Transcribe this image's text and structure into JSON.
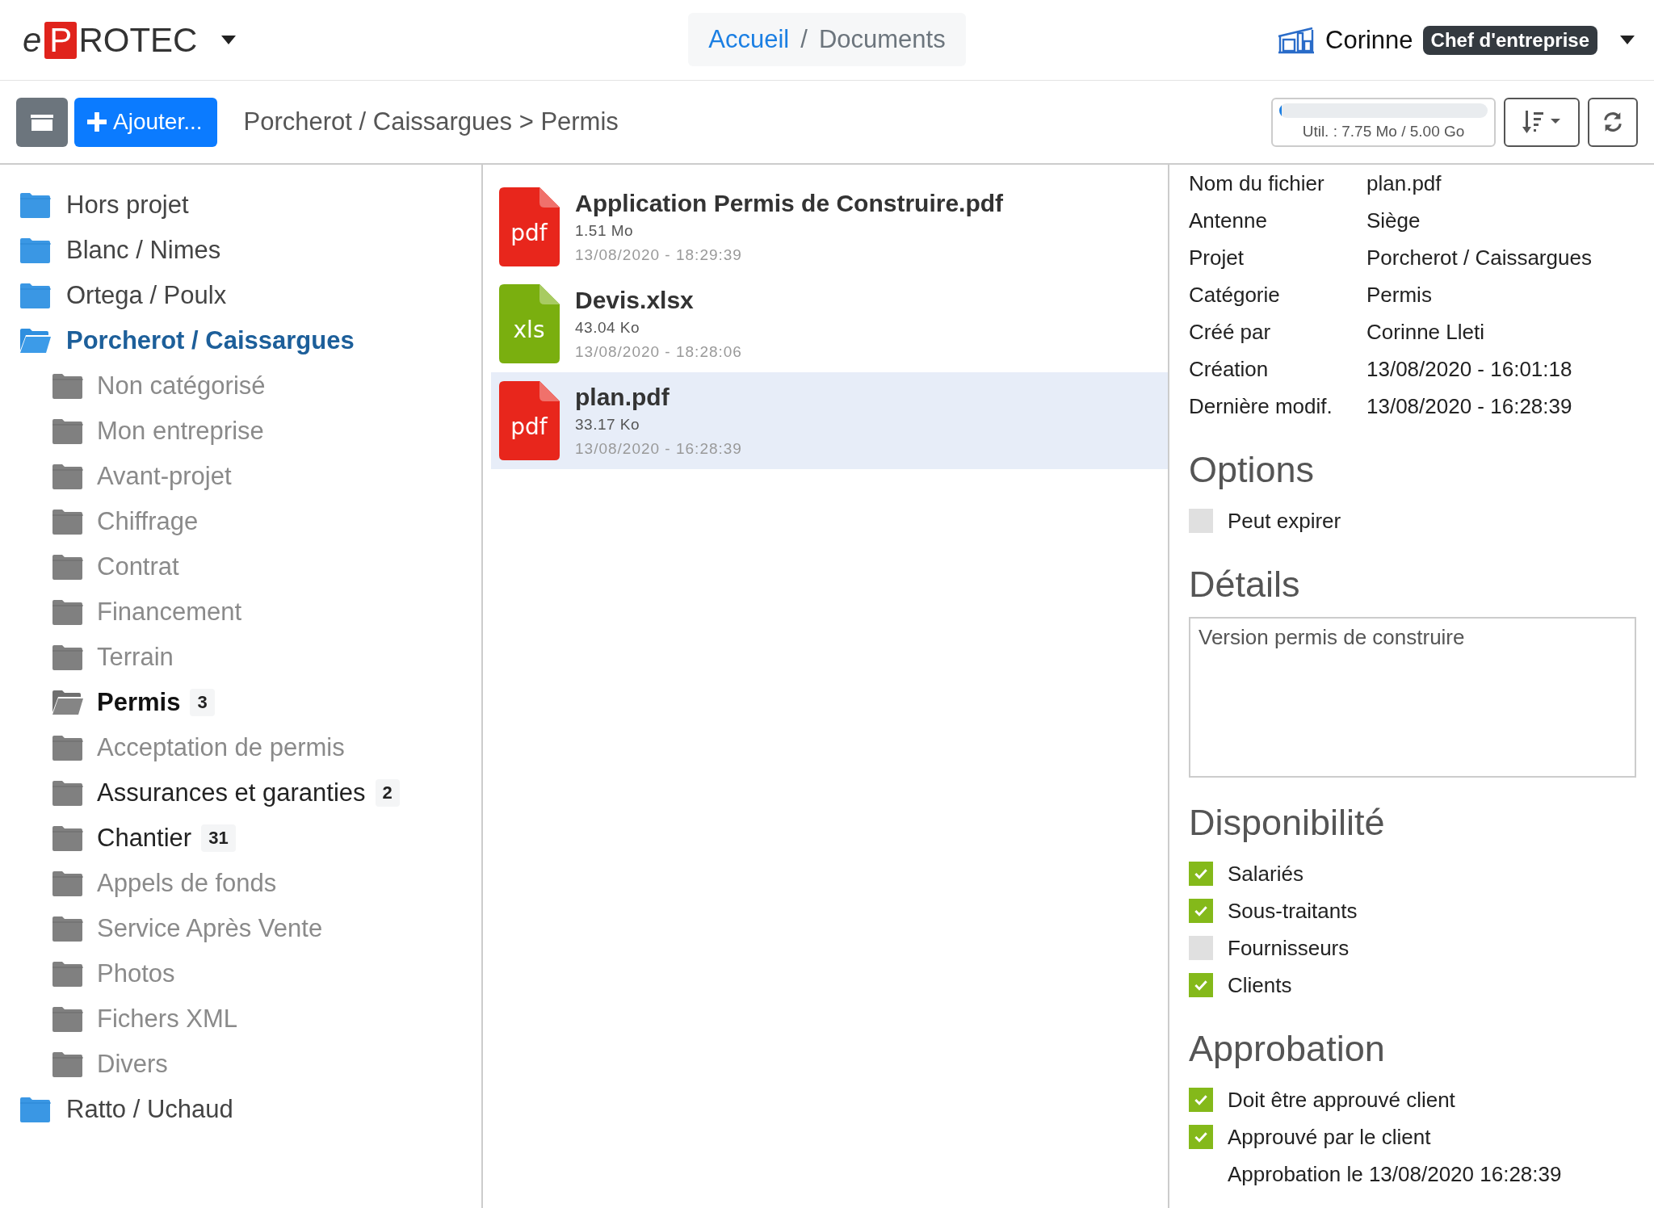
{
  "header": {
    "logo": {
      "prefix": "e",
      "mark": "P",
      "suffix": "ROTEC"
    },
    "breadcrumb_separator": "/",
    "breadcrumb": [
      {
        "label": "Accueil",
        "link": true
      },
      {
        "label": "Documents",
        "link": false
      }
    ],
    "user": {
      "name": "Corinne",
      "role": "Chef d'entreprise"
    }
  },
  "toolbar": {
    "add_button": "Ajouter...",
    "path": "Porcherot / Caissargues > Permis",
    "storage": {
      "level": 0.01,
      "label": "Util. : 7.75 Mo / 5.00 Go"
    }
  },
  "folders": [
    {
      "label": "Hors projet",
      "selected": false,
      "expanded": false
    },
    {
      "label": "Blanc / Nimes",
      "selected": false,
      "expanded": false
    },
    {
      "label": "Ortega / Poulx",
      "selected": false,
      "expanded": false
    },
    {
      "label": "Porcherot / Caissargues",
      "selected": true,
      "expanded": true,
      "children": [
        {
          "label": "Non catégorisé",
          "selected": false,
          "muted": true
        },
        {
          "label": "Mon entreprise",
          "selected": false,
          "muted": true
        },
        {
          "label": "Avant-projet",
          "selected": false,
          "muted": true
        },
        {
          "label": "Chiffrage",
          "selected": false,
          "muted": true
        },
        {
          "label": "Contrat",
          "selected": false,
          "muted": true
        },
        {
          "label": "Financement",
          "selected": false,
          "muted": true
        },
        {
          "label": "Terrain",
          "selected": false,
          "muted": true
        },
        {
          "label": "Permis",
          "selected": true,
          "muted": false,
          "count": "3"
        },
        {
          "label": "Acceptation de permis",
          "selected": false,
          "muted": true
        },
        {
          "label": "Assurances et garanties",
          "selected": false,
          "muted": false,
          "count": "2"
        },
        {
          "label": "Chantier",
          "selected": false,
          "muted": false,
          "count": "31"
        },
        {
          "label": "Appels de fonds",
          "selected": false,
          "muted": true
        },
        {
          "label": "Service Après Vente",
          "selected": false,
          "muted": true
        },
        {
          "label": "Photos",
          "selected": false,
          "muted": true
        },
        {
          "label": "Fichers XML",
          "selected": false,
          "muted": true
        },
        {
          "label": "Divers",
          "selected": false,
          "muted": true
        }
      ]
    },
    {
      "label": "Ratto / Uchaud",
      "selected": false,
      "expanded": false
    }
  ],
  "files": [
    {
      "name": "Application Permis de Construire.pdf",
      "color": "#e8261c",
      "icon_label": "pdf",
      "size": "1.51 Mo",
      "date": "13/08/2020 - 18:29:39",
      "selected": false
    },
    {
      "name": "Devis.xlsx",
      "color": "#7aaf0f",
      "icon_label": "xls",
      "size": "43.04 Ko",
      "date": "13/08/2020 - 18:28:06",
      "selected": false
    },
    {
      "name": "plan.pdf",
      "color": "#e8261c",
      "icon_label": "pdf",
      "size": "33.17 Ko",
      "date": "13/08/2020 - 16:28:39",
      "selected": true
    }
  ],
  "details": {
    "fields": [
      {
        "label": "Nom du fichier",
        "value": "plan.pdf"
      },
      {
        "label": "Antenne",
        "value": "Siège"
      },
      {
        "label": "Projet",
        "value": "Porcherot / Caissargues"
      },
      {
        "label": "Catégorie",
        "value": "Permis"
      },
      {
        "label": "Créé par",
        "value": "Corinne Lleti"
      },
      {
        "label": "Création",
        "value": "13/08/2020 - 16:01:18"
      },
      {
        "label": "Dernière modif.",
        "value": "13/08/2020 - 16:28:39"
      }
    ],
    "sections": [
      {
        "kind": "checklist",
        "title": "Options",
        "items": [
          {
            "label": "Peut expirer",
            "checked": false
          }
        ]
      },
      {
        "kind": "textarea",
        "title": "Détails",
        "value": "Version permis de construire"
      },
      {
        "kind": "checklist",
        "title": "Disponibilité",
        "items": [
          {
            "label": "Salariés",
            "checked": true
          },
          {
            "label": "Sous-traitants",
            "checked": true
          },
          {
            "label": "Fournisseurs",
            "checked": false
          },
          {
            "label": "Clients",
            "checked": true
          }
        ]
      },
      {
        "kind": "checklist",
        "title": "Approbation",
        "items": [
          {
            "label": "Doit être approuvé client",
            "checked": true
          },
          {
            "label": "Approuvé par le client",
            "checked": true
          }
        ],
        "note": "Approbation le 13/08/2020 16:28:39"
      }
    ]
  }
}
